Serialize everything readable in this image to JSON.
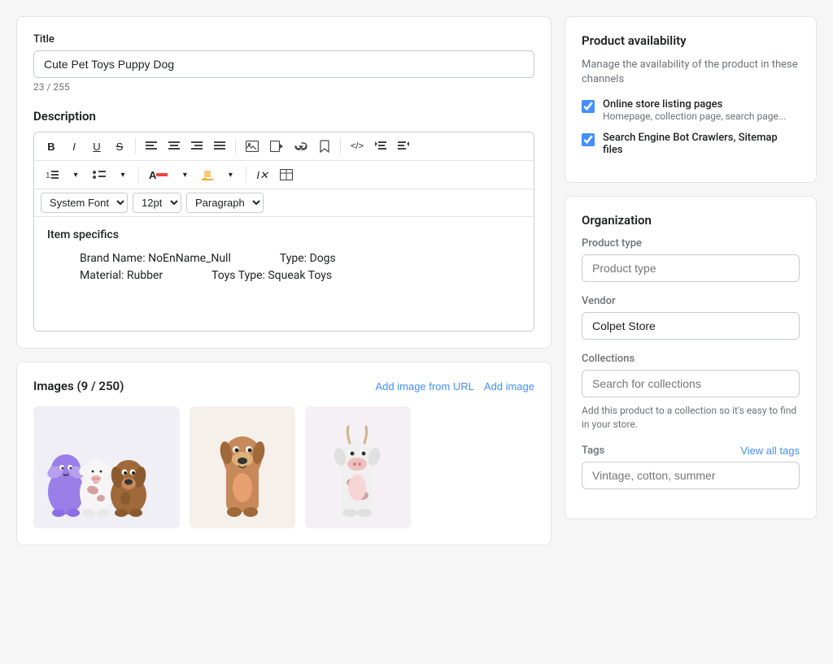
{
  "main": {
    "title_section": {
      "label": "Title",
      "value": "Cute Pet Toys Puppy Dog",
      "char_count": "23 / 255"
    },
    "description_section": {
      "label": "Description",
      "toolbar": {
        "bold": "B",
        "italic": "I",
        "underline": "U",
        "strikethrough": "S",
        "align_left": "≡",
        "align_center": "≡",
        "align_right": "≡",
        "align_justify": "≡",
        "image": "🖼",
        "video": "▶",
        "link": "🔗",
        "bookmark": "🔖",
        "code": "</>",
        "indent_left": "⇤",
        "indent_right": "⇥",
        "font": "System Font",
        "size": "12pt",
        "paragraph": "Paragraph"
      },
      "content": {
        "item_specifics_title": "Item specifics",
        "brand_name": "Brand Name: NoEnName_Null",
        "material": "Material: Rubber",
        "type": "Type: Dogs",
        "toys_type": "Toys Type: Squeak Toys"
      }
    },
    "images_section": {
      "label": "Images (9 / 250)",
      "add_from_url_label": "Add image from URL",
      "add_image_label": "Add image"
    }
  },
  "sidebar": {
    "availability": {
      "title": "Product availability",
      "description": "Manage the availability of the product in these channels",
      "channels": [
        {
          "id": "online-store",
          "label": "Online store listing pages",
          "sublabel": "Homepage, collection page, search page...",
          "checked": true
        },
        {
          "id": "search-engine",
          "label": "Search Engine Bot Crawlers, Sitemap files",
          "sublabel": "",
          "checked": true
        }
      ]
    },
    "organization": {
      "title": "Organization",
      "product_type": {
        "label": "Product type",
        "placeholder": "Product type"
      },
      "vendor": {
        "label": "Vendor",
        "value": "Colpet Store"
      },
      "collections": {
        "label": "Collections",
        "placeholder": "Search for collections",
        "description": "Add this product to a collection so it's easy to find in your store."
      },
      "tags": {
        "label": "Tags",
        "view_all_label": "View all tags",
        "placeholder": "Vintage, cotton, summer"
      }
    }
  }
}
